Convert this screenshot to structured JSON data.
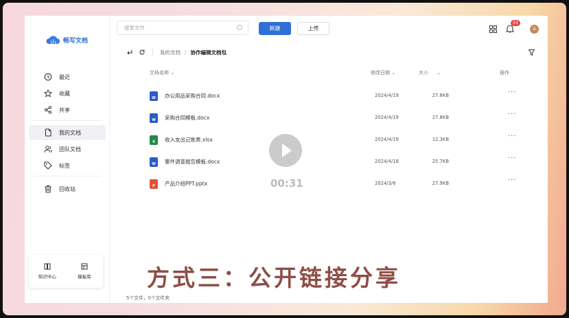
{
  "app": {
    "name": "畅写文档"
  },
  "search": {
    "placeholder": "搜索文件"
  },
  "toolbar": {
    "new_label": "新建",
    "upload_label": "上传"
  },
  "notifications": {
    "count": "33"
  },
  "user": {
    "avatar_initial": "A"
  },
  "sidebar": {
    "items": [
      {
        "label": "最近",
        "icon": "clock-icon"
      },
      {
        "label": "收藏",
        "icon": "star-icon"
      },
      {
        "label": "共享",
        "icon": "share-icon"
      },
      {
        "label": "我的文档",
        "icon": "document-icon",
        "active": true
      },
      {
        "label": "团队文档",
        "icon": "team-icon"
      },
      {
        "label": "标签",
        "icon": "tag-icon"
      },
      {
        "label": "回收站",
        "icon": "trash-icon"
      }
    ],
    "bottom": [
      {
        "label": "知识中心",
        "icon": "book-icon"
      },
      {
        "label": "模板库",
        "icon": "template-icon"
      }
    ]
  },
  "breadcrumb": {
    "root": "我的文档",
    "current": "协作编辑文档包"
  },
  "table": {
    "headers": {
      "name": "文档名称",
      "date": "修改日期",
      "size": "大小",
      "action": "操作"
    },
    "rows": [
      {
        "name": "办公用品采购合同.docx",
        "date": "2024/4/19",
        "size": "27.8KB",
        "type": "word",
        "color": "#2b5cc5",
        "letter": "W"
      },
      {
        "name": "采购合同模板.docx",
        "date": "2024/4/19",
        "size": "27.8KB",
        "type": "word",
        "color": "#2b5cc5",
        "letter": "W"
      },
      {
        "name": "收入支出记账表.xlsx",
        "date": "2024/4/19",
        "size": "12.3KB",
        "type": "excel",
        "color": "#1f8a4c",
        "letter": "X"
      },
      {
        "name": "案件调查报告模板.docx",
        "date": "2024/4/18",
        "size": "25.7KB",
        "type": "word",
        "color": "#2b5cc5",
        "letter": "W"
      },
      {
        "name": "产品介绍PPT.pptx",
        "date": "2024/3/6",
        "size": "27.9KB",
        "type": "ppt",
        "color": "#e0533a",
        "letter": "P"
      }
    ],
    "more_label": "···"
  },
  "status": {
    "text": "5个文件，0个文件夹"
  },
  "video": {
    "timer": "00:31",
    "caption": "方式三：公开链接分享"
  }
}
